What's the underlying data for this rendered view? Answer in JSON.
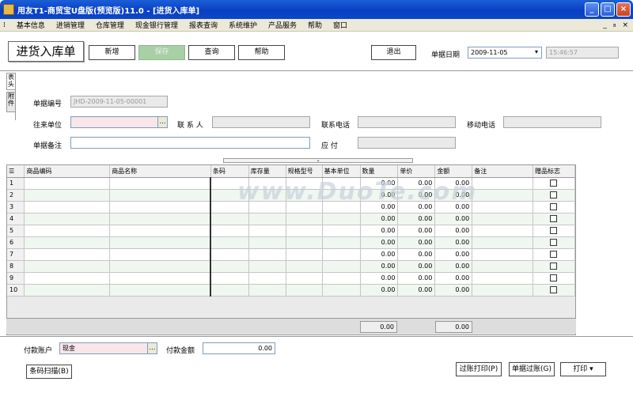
{
  "window": {
    "title": "用友T1-商贸宝U盘版(预览版)11.0 - [进货入库单]",
    "controls": {
      "minimize": "_",
      "maximize": "□",
      "close": "×"
    }
  },
  "menu": {
    "items": [
      "基本信息",
      "进销管理",
      "仓库管理",
      "现金银行管理",
      "报表查询",
      "系统维护",
      "产品服务",
      "帮助",
      "窗口"
    ],
    "mdi_controls": [
      "_",
      "₈",
      "×"
    ]
  },
  "toolbar": {
    "logo": "进货入库单",
    "new_label": "新增",
    "save_label": "保存",
    "query_label": "查询",
    "help_label": "帮助",
    "exit_label": "退出",
    "date_label": "单据日期",
    "date_value": "2009-11-05",
    "time_value": "15:46:57"
  },
  "sidetabs": [
    "表\n头",
    "附\n件"
  ],
  "form": {
    "doc_no_label": "单据编号",
    "doc_no_value": "JHD-2009-11-05-00001",
    "partner_label": "往来单位",
    "contact_label": "联 系 人",
    "phone_label": "联系电话",
    "mobile_label": "移动电话",
    "remark_label": "单据备注",
    "payable_label": "应    付"
  },
  "grid": {
    "headers": [
      "商品编码",
      "商品名称",
      "条码",
      "库存量",
      "规格型号",
      "基本单位",
      "数量",
      "单价",
      "金额",
      "备注",
      "赠品标志"
    ],
    "rows": [
      {
        "no": "1",
        "qty": "0.00",
        "price": "0.00",
        "amount": "0.00"
      },
      {
        "no": "2",
        "qty": "0.00",
        "price": "0.00",
        "amount": "0.00"
      },
      {
        "no": "3",
        "qty": "0.00",
        "price": "0.00",
        "amount": "0.00"
      },
      {
        "no": "4",
        "qty": "0.00",
        "price": "0.00",
        "amount": "0.00"
      },
      {
        "no": "5",
        "qty": "0.00",
        "price": "0.00",
        "amount": "0.00"
      },
      {
        "no": "6",
        "qty": "0.00",
        "price": "0.00",
        "amount": "0.00"
      },
      {
        "no": "7",
        "qty": "0.00",
        "price": "0.00",
        "amount": "0.00"
      },
      {
        "no": "8",
        "qty": "0.00",
        "price": "0.00",
        "amount": "0.00"
      },
      {
        "no": "9",
        "qty": "0.00",
        "price": "0.00",
        "amount": "0.00"
      },
      {
        "no": "10",
        "qty": "0.00",
        "price": "0.00",
        "amount": "0.00"
      }
    ],
    "sum_qty": "0.00",
    "sum_amount": "0.00"
  },
  "bottom": {
    "pay_account_label": "付款账户",
    "pay_account_value": "现金",
    "pay_amount_label": "付款金额",
    "pay_amount_value": "0.00",
    "barcode_label": "条码扫描(B)",
    "post_print_label": "过账打印(P)",
    "post_label": "单据过账(G)",
    "print_label": "打印"
  },
  "watermark": "www.DuoTe.com"
}
